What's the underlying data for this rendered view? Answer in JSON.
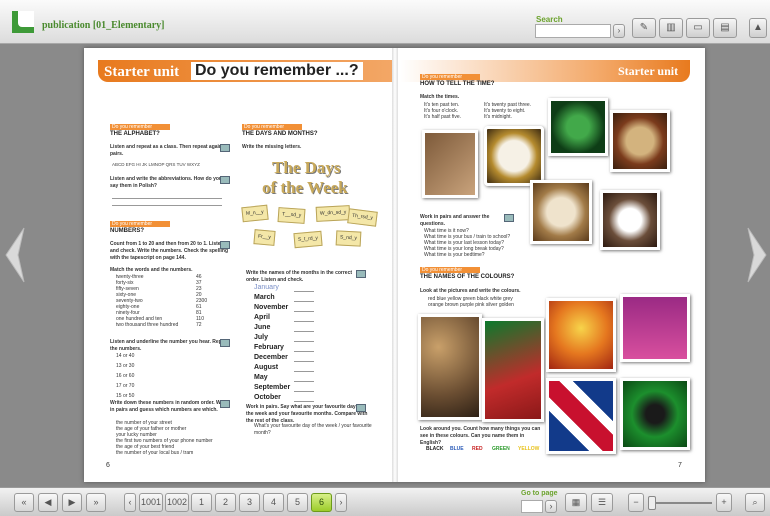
{
  "header": {
    "title": "publication [01_Elementary]",
    "search_label": "Search"
  },
  "footer": {
    "page_buttons": [
      "1001",
      "1002",
      "1",
      "2",
      "3",
      "4",
      "5",
      "6"
    ],
    "goto_label": "Go to page"
  },
  "left_page": {
    "header_a": "Starter unit",
    "header_b": "Do you remember ...?",
    "tag_label": "Do you remember",
    "sec1_title": "THE ALPHABET?",
    "ex1": "Listen and repeat as a class. Then repeat again in pairs.",
    "alphabet": "ABCD  EFG  HI  JK  LMNOP  QRS  TUV  WXYZ",
    "ex2": "Listen and write the abbreviations. How do you say them in Polish?",
    "sec2_title": "NUMBERS?",
    "ex3": "Count from 1 to 20 and then from 20 to 1. Listen and check. Write the numbers. Check the spelling with the tapescript on page 144.",
    "ex4": "Match the words and the numbers.",
    "words": [
      "twenty-three",
      "forty-six",
      "fifty-seven",
      "sixty-one",
      "seventy-two",
      "eighty-one",
      "ninety-four",
      "one hundred and ten",
      "two thousand three hundred"
    ],
    "nums": [
      "46",
      "37",
      "23",
      "20",
      "2300",
      "61",
      "81",
      "110",
      "72"
    ],
    "ex5": "Listen and underline the number you hear. Repeat the numbers.",
    "pairs": [
      "14 or 40",
      "13 or 30",
      "16 or 60",
      "17 or 70",
      "15 or 50"
    ],
    "ex6": "Write down these numbers in random order. Work in pairs and guess which numbers are which.",
    "ex6_items": [
      "the number of your street",
      "the age of your father or mother",
      "your lucky number",
      "the first two numbers of your phone number",
      "the age of your best friend",
      "the number of your local bus / tram"
    ],
    "sec3_title": "THE DAYS AND MONTHS?",
    "ex7": "Write the missing letters.",
    "days_title_1": "The Days",
    "days_title_2": "of the Week",
    "cards": [
      "M_n__y",
      "T__sd_y",
      "W_dn_sd_y",
      "Th_rsd_y",
      "Fr__y",
      "S_t_rd_y",
      "S_nd_y"
    ],
    "ex8": "Write the names of the months in the correct order. Listen and check.",
    "months": [
      "January",
      "March",
      "November",
      "April",
      "June",
      "July",
      "February",
      "December",
      "August",
      "May",
      "September",
      "October"
    ],
    "ex9": "Work in pairs. Say what are your favourite days of the week and your favourite months. Compare with the rest of the class.",
    "ex9_note": "What's your favourite day of the week / your favourite month?",
    "page_number": "6"
  },
  "right_page": {
    "header": "Starter unit",
    "tag_label": "Do you remember",
    "sec1_title": "HOW TO TELL THE TIME?",
    "ex10": "Match the times.",
    "times": [
      "It's ten past ten.",
      "It's four o'clock.",
      "It's half past five.",
      "It's twenty past three.",
      "It's twenty to eight.",
      "It's midnight."
    ],
    "ex11": "Work in pairs and answer the questions.",
    "questions": [
      "What time is it now?",
      "What time is your bus / train to school?",
      "What time is your last lesson today?",
      "What time is your long break today?",
      "What time is your bedtime?"
    ],
    "sec2_title": "THE NAMES OF THE COLOURS?",
    "ex12": "Look at the pictures and write the colours.",
    "colours_row1": "red   blue   yellow   green   black   white   grey",
    "colours_row2": "orange   brown   purple   pink   silver   golden",
    "ex13": "Look around you. Count how many things you can see in these colours. Can you name them in English?",
    "colour_words": [
      "BLACK",
      "BLUE",
      "RED",
      "GREEN",
      "YELLOW"
    ],
    "page_number": "7"
  },
  "colors": {
    "accent": "#e87a1e",
    "brand": "#4a8a2e"
  }
}
